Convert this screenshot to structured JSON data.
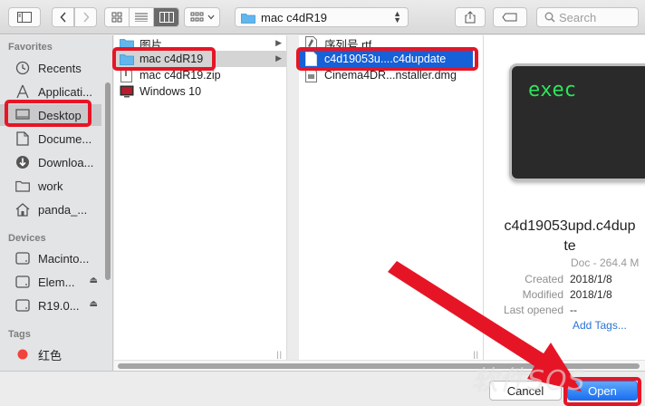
{
  "toolbar": {
    "path_label": "mac c4dR19",
    "search_placeholder": "Search"
  },
  "sidebar": {
    "favorites_header": "Favorites",
    "favorites": [
      {
        "label": "Recents",
        "icon": "clock-icon"
      },
      {
        "label": "Applicati...",
        "icon": "applications-icon"
      },
      {
        "label": "Desktop",
        "icon": "desktop-icon"
      },
      {
        "label": "Docume...",
        "icon": "document-icon"
      },
      {
        "label": "Downloa...",
        "icon": "download-icon"
      },
      {
        "label": "work",
        "icon": "folder-icon"
      },
      {
        "label": "panda_...",
        "icon": "home-icon"
      }
    ],
    "devices_header": "Devices",
    "devices": [
      {
        "label": "Macinto...",
        "icon": "drive-icon"
      },
      {
        "label": "Elem...",
        "icon": "drive-icon"
      },
      {
        "label": "R19.0...",
        "icon": "drive-icon"
      }
    ],
    "tags_header": "Tags",
    "tags": [
      {
        "label": "红色",
        "color": "#f0443c"
      }
    ]
  },
  "column1": {
    "items": [
      {
        "label": "图片",
        "icon": "folder-icon",
        "has_children": true
      },
      {
        "label": "mac c4dR19",
        "icon": "folder-icon",
        "has_children": true
      },
      {
        "label": "mac c4dR19.zip",
        "icon": "zip-icon",
        "has_children": false
      },
      {
        "label": "Windows 10",
        "icon": "windows-icon",
        "has_children": false
      }
    ]
  },
  "column2": {
    "items": [
      {
        "label": "序列号.rtf",
        "icon": "rtf-icon"
      },
      {
        "label": "c4d19053u....c4dupdate",
        "icon": "file-icon"
      },
      {
        "label": "Cinema4DR...nstaller.dmg",
        "icon": "dmg-icon"
      }
    ]
  },
  "preview": {
    "icon_text": "exec",
    "name_line1": "c4d19053upd.c4dup",
    "name_line2": "te",
    "kind": "Doc - 264.4 M",
    "created_label": "Created",
    "created_value": "2018/1/8",
    "modified_label": "Modified",
    "modified_value": "2018/1/8",
    "last_opened_label": "Last opened",
    "last_opened_value": "--",
    "add_tags": "Add Tags..."
  },
  "buttons": {
    "cancel": "Cancel",
    "open": "Open"
  },
  "watermark": "软件SOS",
  "colors": {
    "accent": "#1660d8",
    "highlight": "#e61526",
    "exec_text": "#2ee55a"
  }
}
